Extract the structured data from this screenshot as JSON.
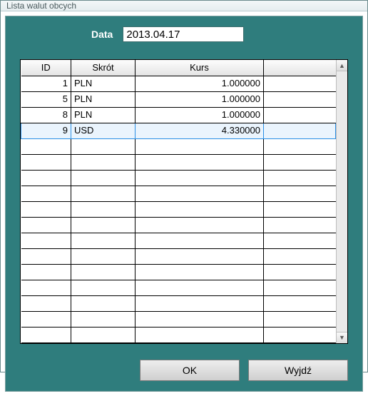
{
  "window": {
    "title": "Lista walut obcych"
  },
  "form": {
    "date_label": "Data",
    "date_value": "2013.04.17"
  },
  "grid": {
    "headers": {
      "id": "ID",
      "code": "Skrót",
      "rate": "Kurs"
    },
    "rows": [
      {
        "id": "1",
        "code": "PLN",
        "rate": "1.000000",
        "selected": false
      },
      {
        "id": "5",
        "code": "PLN",
        "rate": "1.000000",
        "selected": false
      },
      {
        "id": "8",
        "code": "PLN",
        "rate": "1.000000",
        "selected": false
      },
      {
        "id": "9",
        "code": "USD",
        "rate": "4.330000",
        "selected": true
      }
    ],
    "empty_rows": 13
  },
  "buttons": {
    "ok": "OK",
    "exit": "Wyjdź"
  }
}
